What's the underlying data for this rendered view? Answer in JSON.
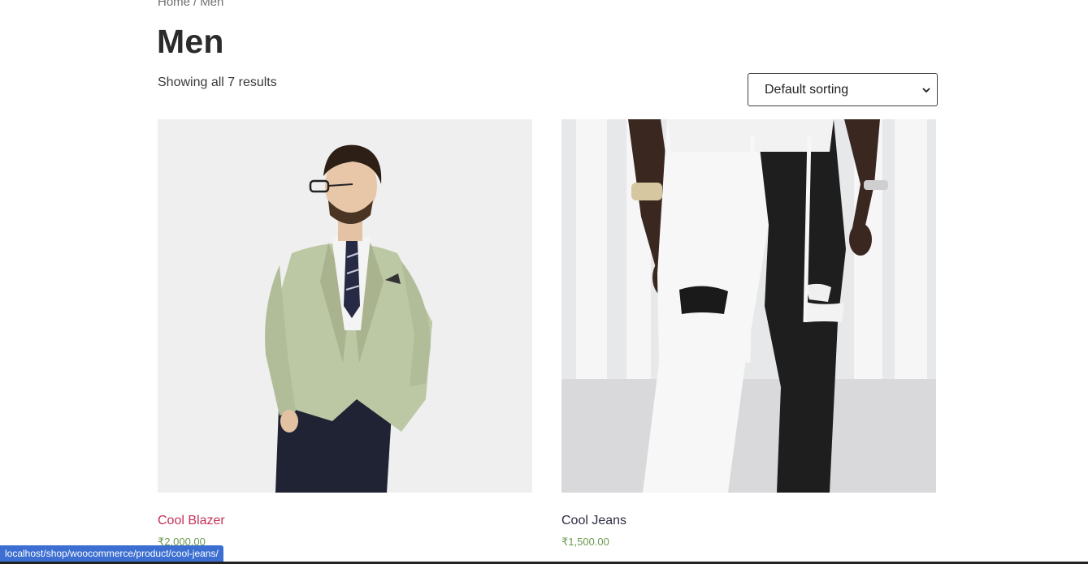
{
  "breadcrumb": {
    "home": "Home",
    "separator": "/",
    "current": "Men"
  },
  "page": {
    "title": "Men",
    "result_count": "Showing all 7 results"
  },
  "sorting": {
    "selected": "Default sorting"
  },
  "products": [
    {
      "title": "Cool Blazer",
      "price": "₹2,000.00",
      "image": "blazer-photo"
    },
    {
      "title": "Cool Jeans",
      "price": "₹1,500.00",
      "image": "jeans-photo"
    }
  ],
  "status_bar": {
    "url": "localhost/shop/woocommerce/product/cool-jeans/"
  },
  "colors": {
    "link_accent": "#c4315a",
    "price_green": "#6c9a52",
    "status_blue": "#3c6fd1",
    "title_dark": "#2b2b2b"
  }
}
